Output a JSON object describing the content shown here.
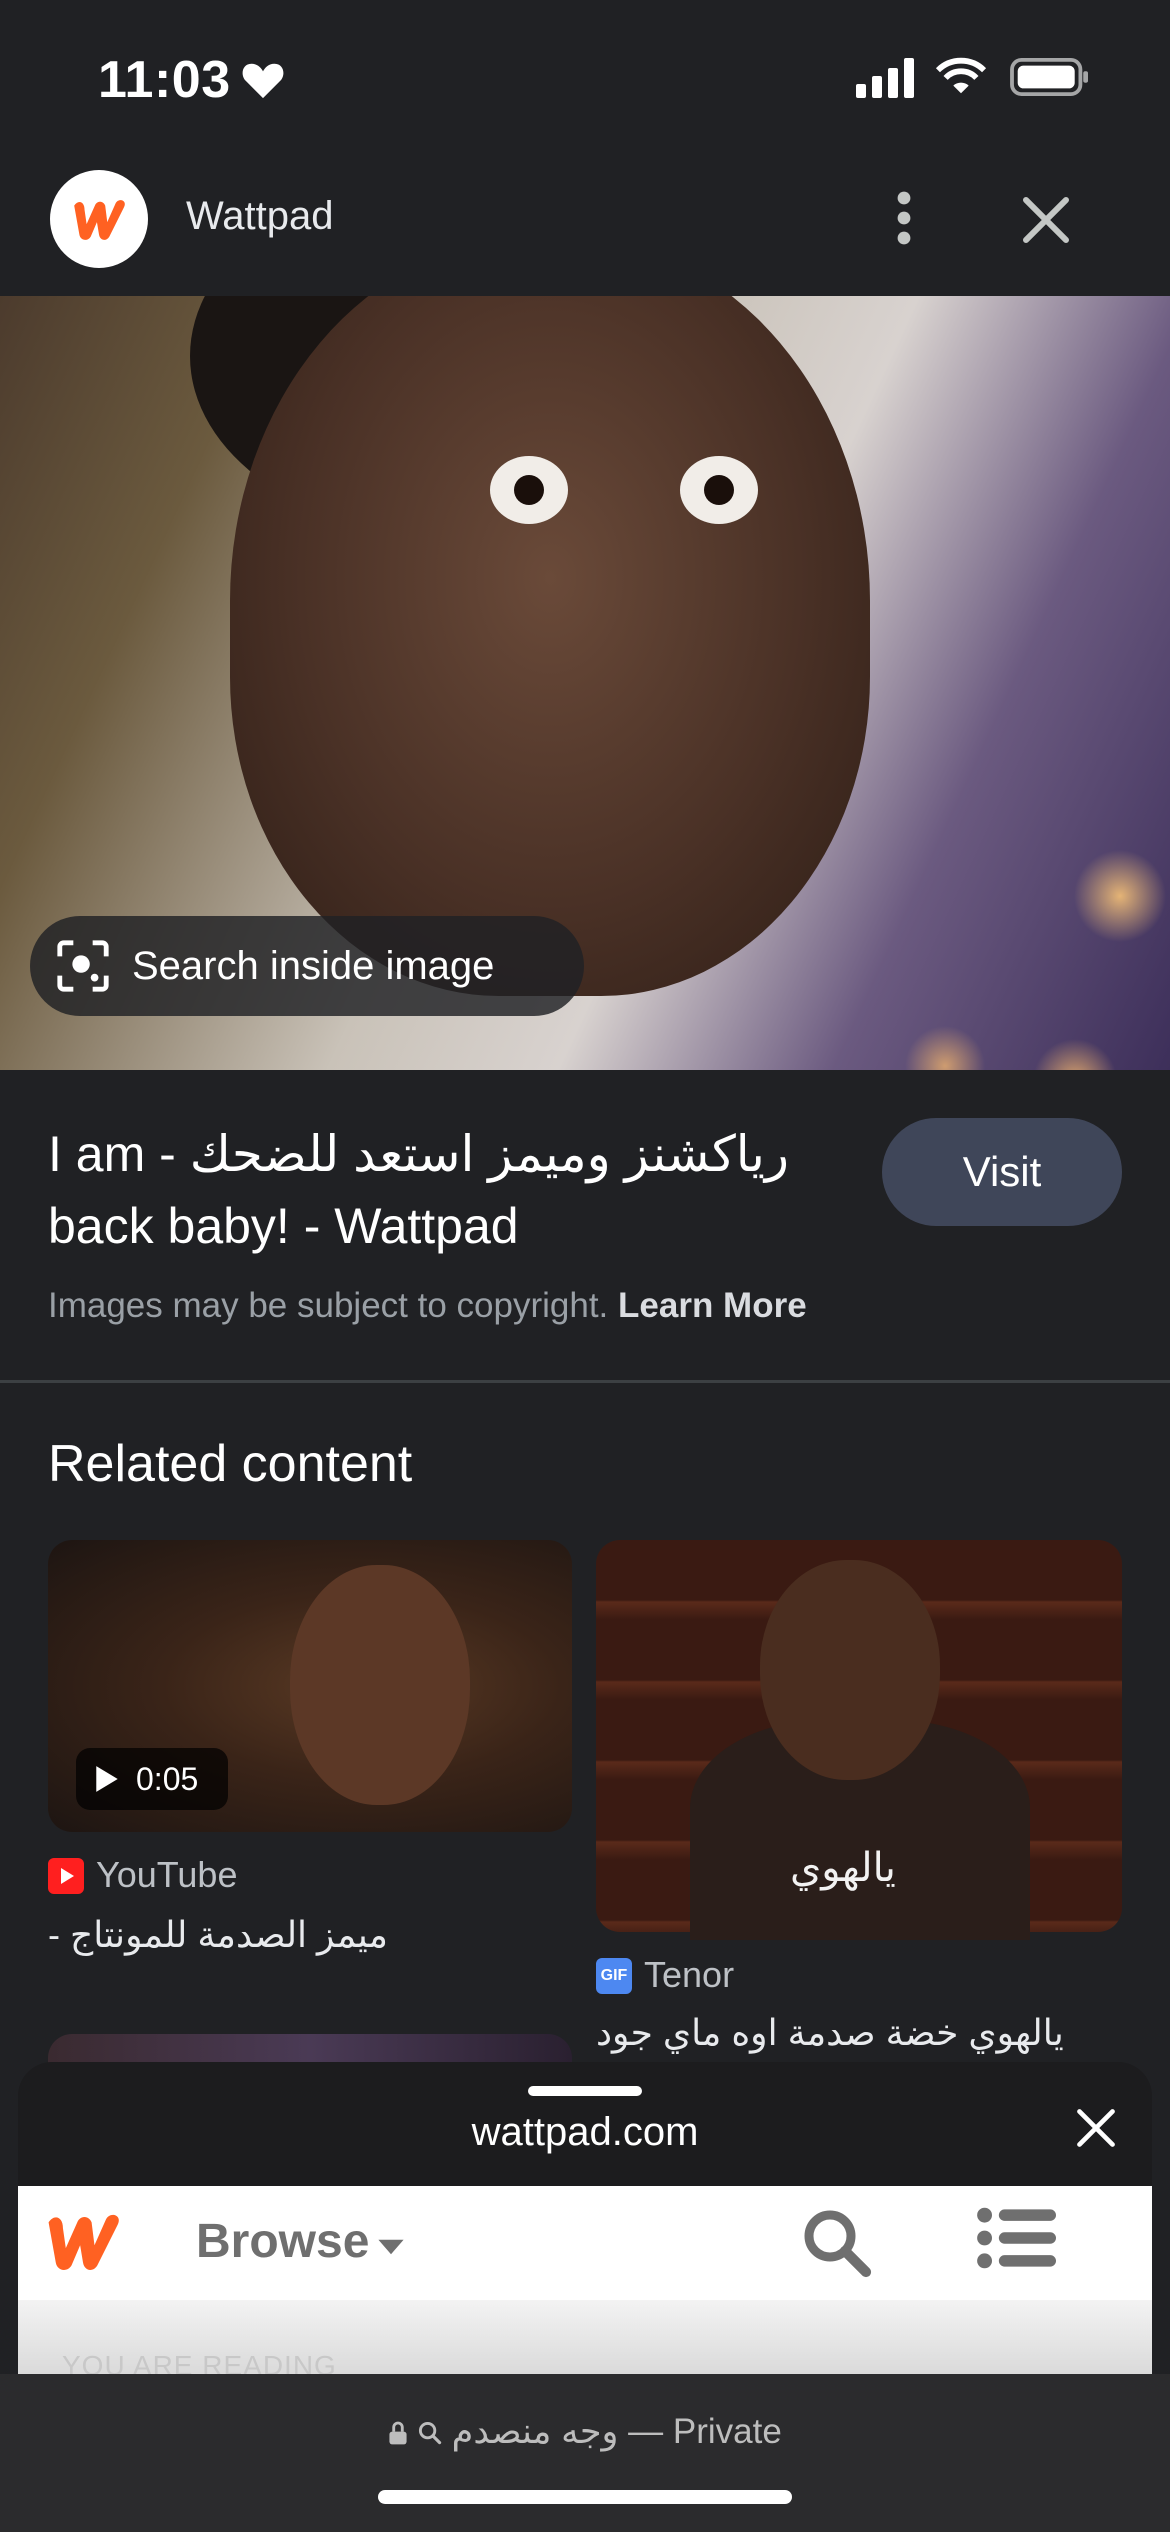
{
  "status_bar": {
    "time": "11:03"
  },
  "header": {
    "title": "Wattpad"
  },
  "image_overlay": {
    "search_label": "Search inside image"
  },
  "result": {
    "title": "I am - رياكشنز وميمز استعد للضحك back baby! - Wattpad",
    "visit_label": "Visit",
    "copyright_text": "Images may be subject to copyright.",
    "learn_more": "Learn More"
  },
  "related": {
    "heading": "Related content",
    "cards": [
      {
        "duration": "0:05",
        "source": "YouTube",
        "caption": "ميمز الصدمة للمونتاج -"
      },
      {
        "overlay_text": "يالهوي",
        "source": "Tenor",
        "caption": "يالهوي خضة صدمة اوه ماي جود"
      }
    ]
  },
  "sheet": {
    "domain": "wattpad.com",
    "browse_label": "Browse",
    "reading_label": "YOU ARE READING"
  },
  "safari": {
    "url_text": "وجه منصدم — Private"
  },
  "colors": {
    "accent_orange": "#ff6122",
    "visit_bg": "#3f4659",
    "background": "#202124"
  }
}
